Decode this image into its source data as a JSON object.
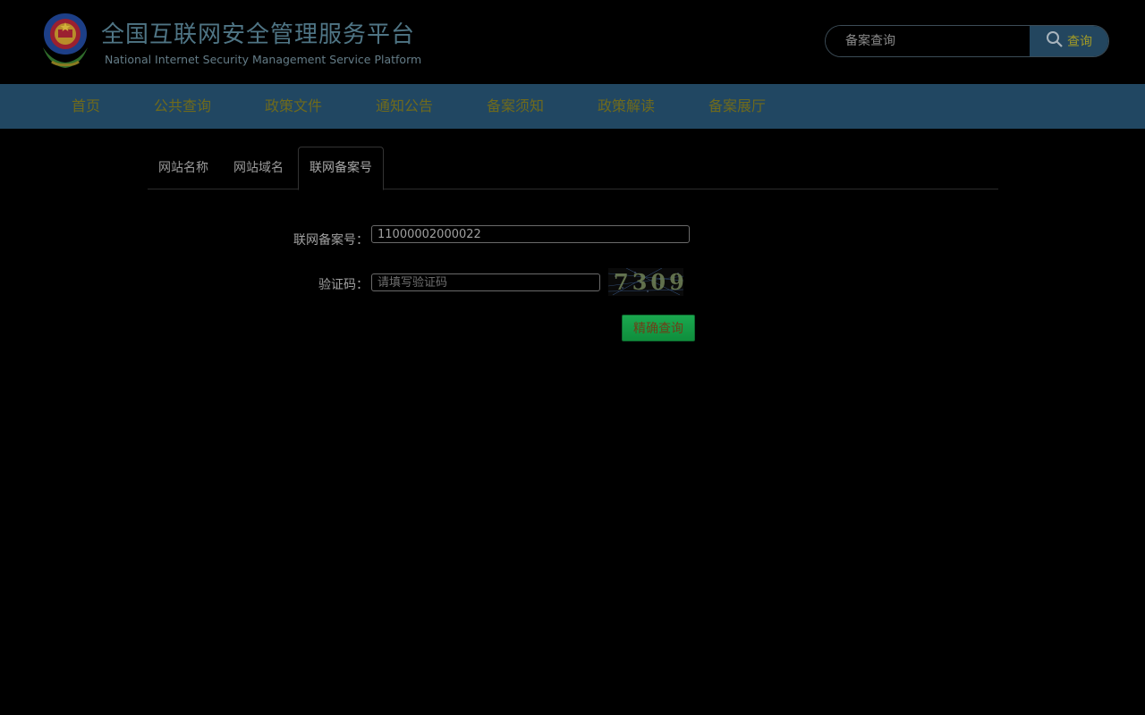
{
  "header": {
    "title": "全国互联网安全管理服务平台",
    "subtitle": "National Internet Security Management Service Platform",
    "logo_icon": "police-emblem-icon"
  },
  "search": {
    "placeholder": "备案查询",
    "button_label": "查询",
    "button_icon": "search-icon"
  },
  "nav": {
    "items": [
      {
        "label": "首页"
      },
      {
        "label": "公共查询"
      },
      {
        "label": "政策文件"
      },
      {
        "label": "通知公告"
      },
      {
        "label": "备案须知"
      },
      {
        "label": "政策解读"
      },
      {
        "label": "备案展厅"
      }
    ]
  },
  "tabs": [
    {
      "label": "网站名称",
      "active": false
    },
    {
      "label": "网站域名",
      "active": false
    },
    {
      "label": "联网备案号",
      "active": true
    }
  ],
  "form": {
    "record_label": "联网备案号：",
    "record_value": "11000002000022",
    "captcha_label": "验证码：",
    "captcha_placeholder": "请填写验证码",
    "captcha_text": "7309",
    "submit_label": "精确查询"
  },
  "colors": {
    "navbar": "#214762",
    "submit": "#1aa84f"
  }
}
